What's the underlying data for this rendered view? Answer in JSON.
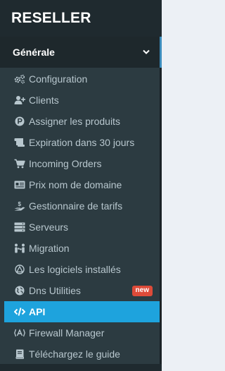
{
  "brand": {
    "title": "RESELLER"
  },
  "section": {
    "title": "Générale"
  },
  "menu": {
    "items": [
      {
        "label": "Configuration",
        "icon": "cogs-icon"
      },
      {
        "label": "Clients",
        "icon": "user-plus-icon"
      },
      {
        "label": "Assigner les produits",
        "icon": "product-p-icon"
      },
      {
        "label": "Expiration dans 30 jours",
        "icon": "scroll-icon"
      },
      {
        "label": "Incoming Orders",
        "icon": "cart-icon"
      },
      {
        "label": "Prix nom de domaine",
        "icon": "id-card-icon"
      },
      {
        "label": "Gestionnaire de tarifs",
        "icon": "hand-dollar-icon"
      },
      {
        "label": "Serveurs",
        "icon": "server-icon"
      },
      {
        "label": "Migration",
        "icon": "people-arrows-icon"
      },
      {
        "label": "Les logiciels installés",
        "icon": "software-icon"
      },
      {
        "label": "Dns Utilities",
        "icon": "globe-icon",
        "badge": "new"
      },
      {
        "label": "API",
        "icon": "code-icon",
        "active": true
      },
      {
        "label": "Firewall Manager",
        "icon": "firewall-icon"
      },
      {
        "label": "Téléchargez le guide",
        "icon": "book-icon"
      }
    ]
  },
  "colors": {
    "sidebar_bg": "#222d32",
    "submenu_bg": "#2c3b41",
    "active_bg": "#1ea3dd",
    "badge_bg": "#dd4b39",
    "accent_border": "#3c8dbc"
  }
}
